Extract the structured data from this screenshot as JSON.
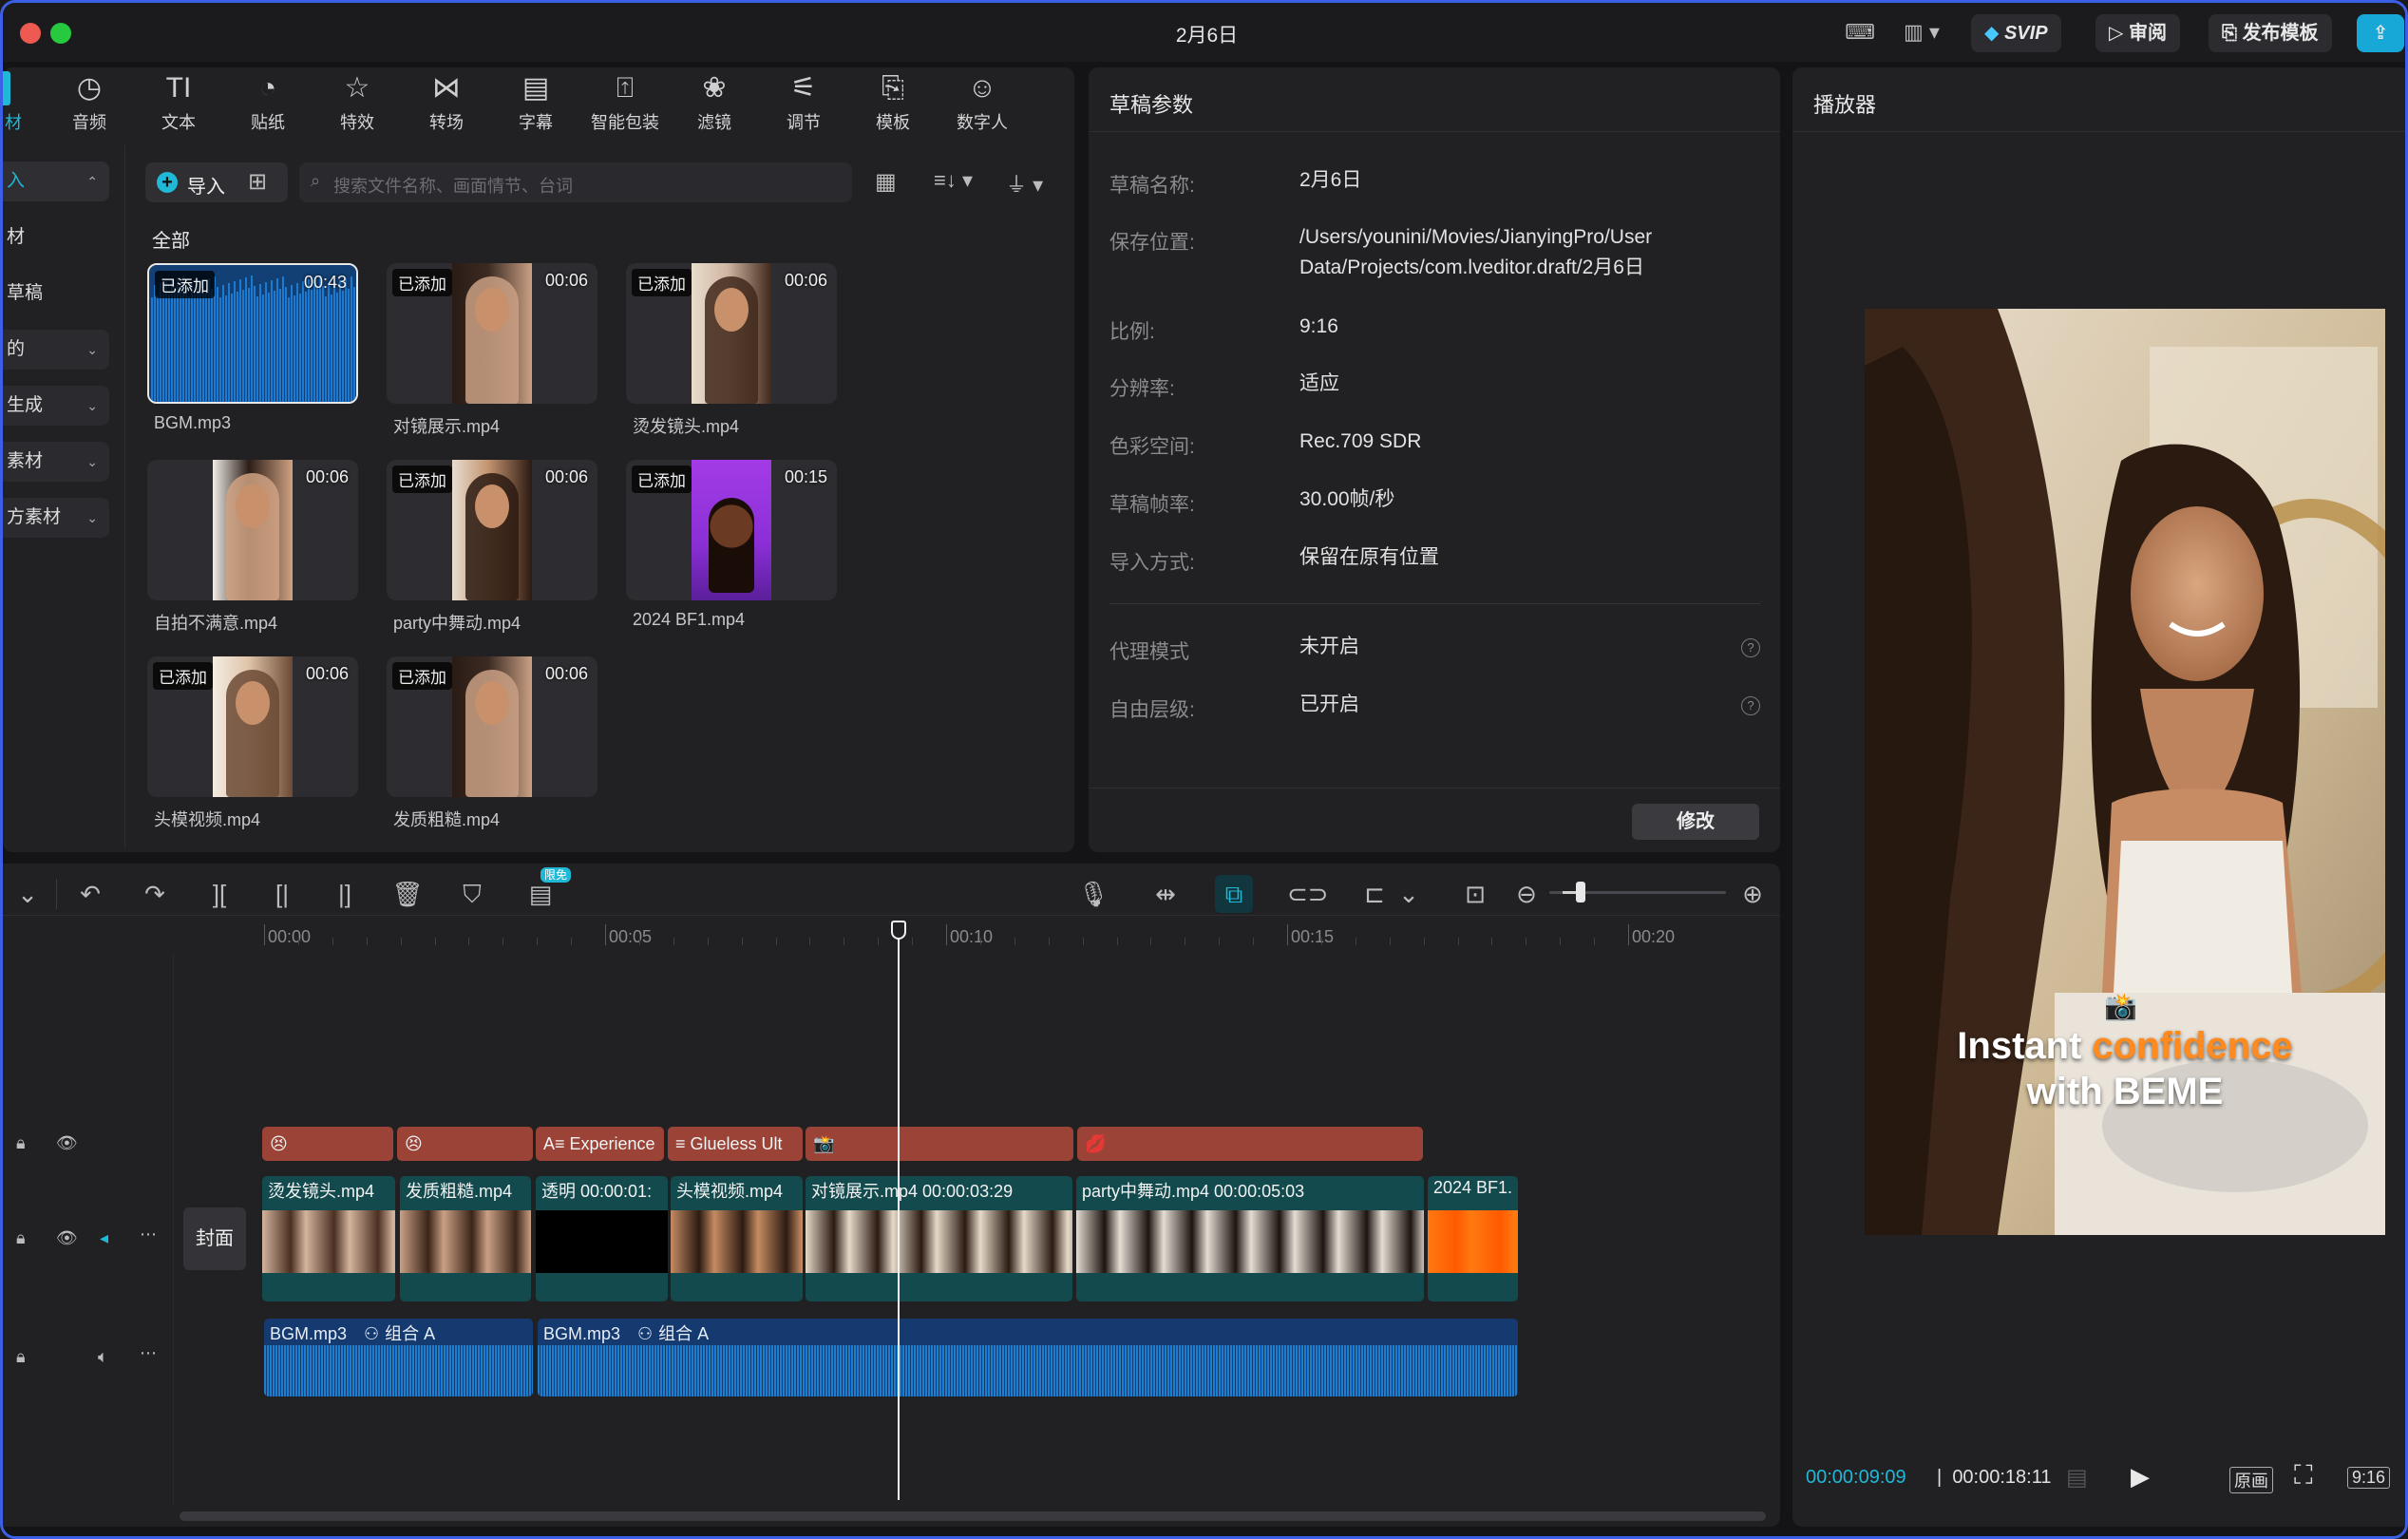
{
  "window": {
    "title": "2月6日",
    "traffic": [
      "#ee5a52",
      "#f5bf2f",
      "#27c93f"
    ]
  },
  "titlebar": {
    "svip": "SVIP",
    "review": "审阅",
    "publish": "发布模板"
  },
  "toolbar": {
    "items": [
      {
        "icon": "◷",
        "label": "音频"
      },
      {
        "icon": "TI",
        "label": "文本"
      },
      {
        "icon": "◔",
        "label": "贴纸"
      },
      {
        "icon": "☆",
        "label": "特效"
      },
      {
        "icon": "⋈",
        "label": "转场"
      },
      {
        "icon": "▤",
        "label": "字幕"
      },
      {
        "icon": "⍐",
        "label": "智能包装"
      },
      {
        "icon": "❀",
        "label": "滤镜"
      },
      {
        "icon": "⚟",
        "label": "调节"
      },
      {
        "icon": "⎘",
        "label": "模板"
      },
      {
        "icon": "☺",
        "label": "数字人"
      }
    ],
    "first_partial": "材"
  },
  "sidebar": {
    "items": [
      {
        "label": "入",
        "active": true
      },
      {
        "label": "材",
        "active": false
      },
      {
        "label": "草稿",
        "active": false
      },
      {
        "label": "的",
        "active": false
      },
      {
        "label": "生成",
        "active": false
      },
      {
        "label": "素材",
        "active": false
      },
      {
        "label": "方素材",
        "active": false
      }
    ]
  },
  "media": {
    "import_label": "导入",
    "search_placeholder": "搜索文件名称、画面情节、台词",
    "section": "全部",
    "added_label": "已添加",
    "items": [
      {
        "name": "BGM.mp3",
        "duration": "00:43",
        "added": true,
        "kind": "audio"
      },
      {
        "name": "对镜展示.mp4",
        "duration": "00:06",
        "added": true,
        "kind": "video"
      },
      {
        "name": "烫发镜头.mp4",
        "duration": "00:06",
        "added": true,
        "kind": "video"
      },
      {
        "name": "自拍不满意.mp4",
        "duration": "00:06",
        "added": false,
        "kind": "video"
      },
      {
        "name": "party中舞动.mp4",
        "duration": "00:06",
        "added": true,
        "kind": "video"
      },
      {
        "name": "2024 BF1.mp4",
        "duration": "00:15",
        "added": true,
        "kind": "purple"
      },
      {
        "name": "头模视频.mp4",
        "duration": "00:06",
        "added": true,
        "kind": "video"
      },
      {
        "name": "发质粗糙.mp4",
        "duration": "00:06",
        "added": true,
        "kind": "video"
      }
    ]
  },
  "draft": {
    "header": "草稿参数",
    "rows": [
      {
        "key": "草稿名称:",
        "value": "2月6日"
      },
      {
        "key": "保存位置:",
        "value": "/Users/younini/Movies/JianyingPro/User",
        "value2": "Data/Projects/com.lveditor.draft/2月6日"
      },
      {
        "key": "比例:",
        "value": "9:16"
      },
      {
        "key": "分辨率:",
        "value": "适应"
      },
      {
        "key": "色彩空间:",
        "value": "Rec.709 SDR"
      },
      {
        "key": "草稿帧率:",
        "value": "30.00帧/秒"
      },
      {
        "key": "导入方式:",
        "value": "保留在原有位置"
      }
    ],
    "rows2": [
      {
        "key": "代理模式",
        "value": "未开启"
      },
      {
        "key": "自由层级:",
        "value": "已开启"
      }
    ],
    "modify": "修改"
  },
  "player": {
    "header": "播放器",
    "caption_line1_a": "Instant ",
    "caption_line1_b": "confidence",
    "caption_line2": "with BEME",
    "accent": "#ff8a1f",
    "current_time": "00:00:09:09",
    "total_time": "00:00:18:11",
    "original_label": "原画",
    "ratio_label": "9:16"
  },
  "timeline": {
    "free_badge": "限免",
    "ruler": [
      "00:00",
      "00:05",
      "00:10",
      "00:15",
      "00:20"
    ],
    "cover_label": "封面",
    "fx_clips": [
      {
        "label": "😣"
      },
      {
        "label": "😣"
      },
      {
        "label": "A≡ Experience"
      },
      {
        "label": "≡ Glueless Ult"
      },
      {
        "label": "📸"
      },
      {
        "label": "💋"
      }
    ],
    "video_clips": [
      {
        "label": "烫发镜头.mp4"
      },
      {
        "label": "发质粗糙.mp4"
      },
      {
        "label": "透明  00:00:01:"
      },
      {
        "label": "头模视频.mp4"
      },
      {
        "label": "对镜展示.mp4  00:00:03:29"
      },
      {
        "label": "party中舞动.mp4  00:00:05:03"
      },
      {
        "label": "2024 BF1."
      }
    ],
    "audio_clips": [
      {
        "name": "BGM.mp3",
        "group": "组合 A"
      },
      {
        "name": "BGM.mp3",
        "group": "组合 A"
      }
    ],
    "accent": "#1fb8d6"
  }
}
